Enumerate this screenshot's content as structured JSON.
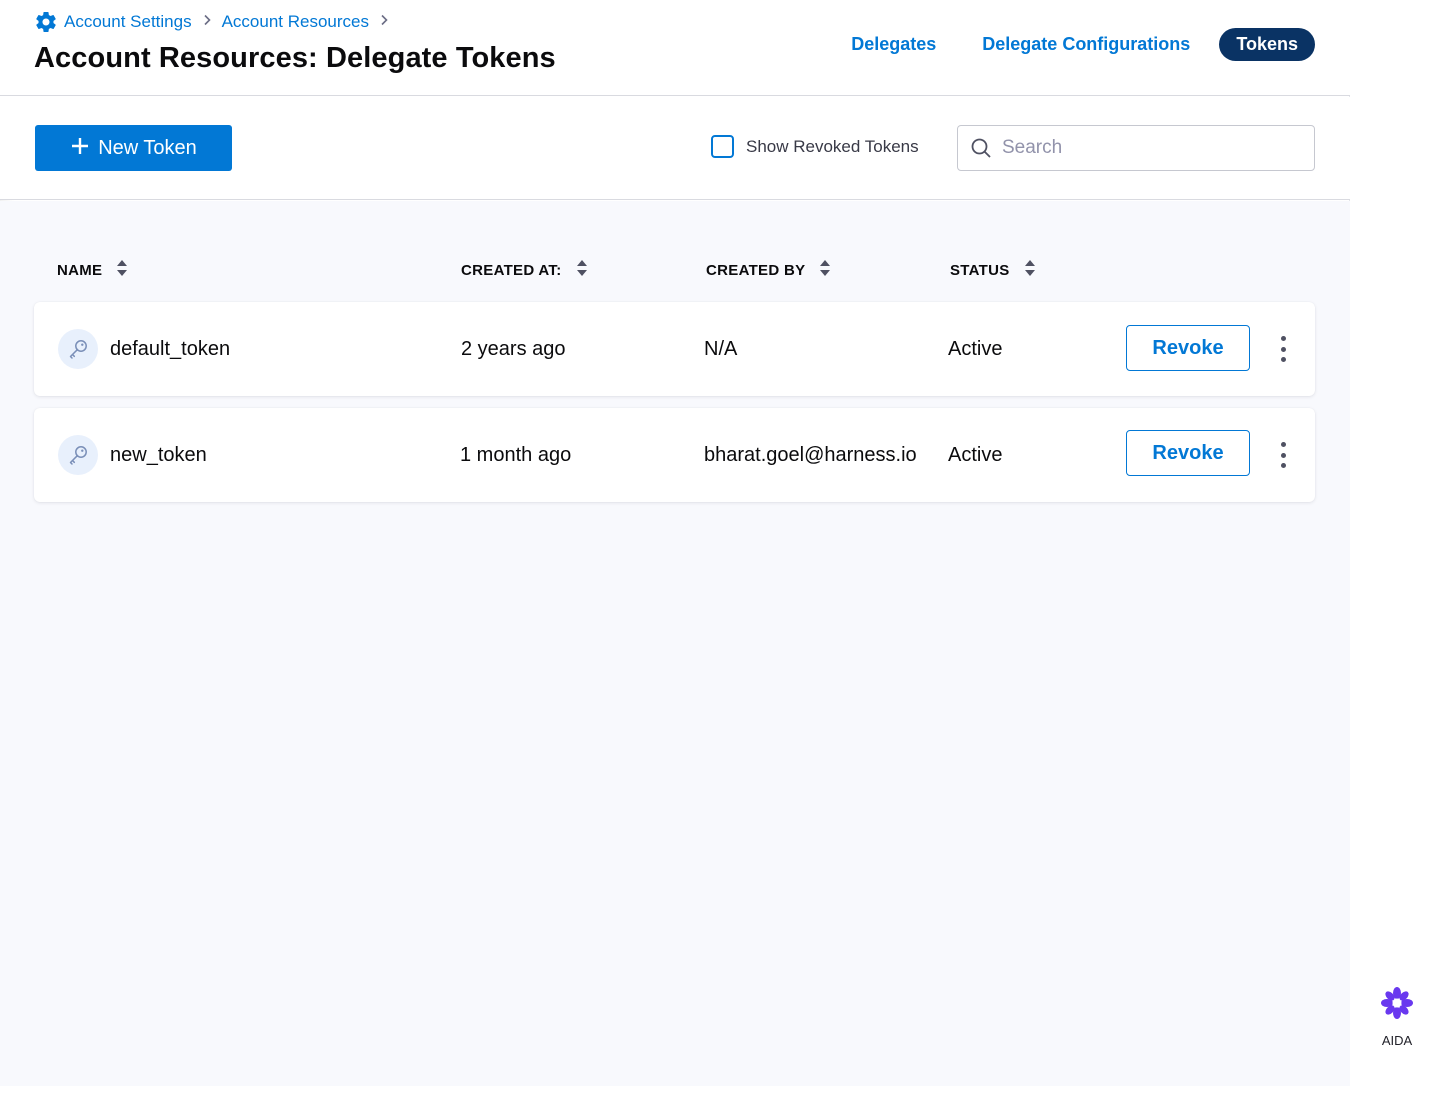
{
  "breadcrumb": {
    "items": [
      {
        "label": "Account Settings"
      },
      {
        "label": "Account Resources"
      }
    ]
  },
  "page_title": "Account Resources: Delegate Tokens",
  "tabs": [
    {
      "label": "Delegates",
      "active": false
    },
    {
      "label": "Delegate Configurations",
      "active": false
    },
    {
      "label": "Tokens",
      "active": true
    }
  ],
  "toolbar": {
    "new_token_label": "New Token",
    "show_revoked_label": "Show Revoked Tokens",
    "show_revoked_checked": false,
    "search_placeholder": "Search",
    "search_value": ""
  },
  "table": {
    "columns": [
      "NAME",
      "CREATED AT:",
      "CREATED BY",
      "STATUS"
    ],
    "rows": [
      {
        "name": "default_token",
        "created_at": "2 years ago",
        "created_by": "N/A",
        "status": "Active",
        "action": "Revoke"
      },
      {
        "name": "new_token",
        "created_at": "1 month ago",
        "created_by": "bharat.goel@harness.io",
        "status": "Active",
        "action": "Revoke"
      }
    ]
  },
  "aida": {
    "label": "AIDA"
  },
  "colors": {
    "accent": "#0278d5",
    "active_tab_bg": "#0a3364",
    "title_text": "#0b0b0d",
    "aida_purple": "#6938ef"
  },
  "icons": {
    "breadcrumb": "gear-icon",
    "new_token": "plus-icon",
    "search": "search-icon",
    "row": "key-icon",
    "sort": "sort-icon",
    "menu": "more-vertical-icon",
    "aida": "aida-icon"
  }
}
